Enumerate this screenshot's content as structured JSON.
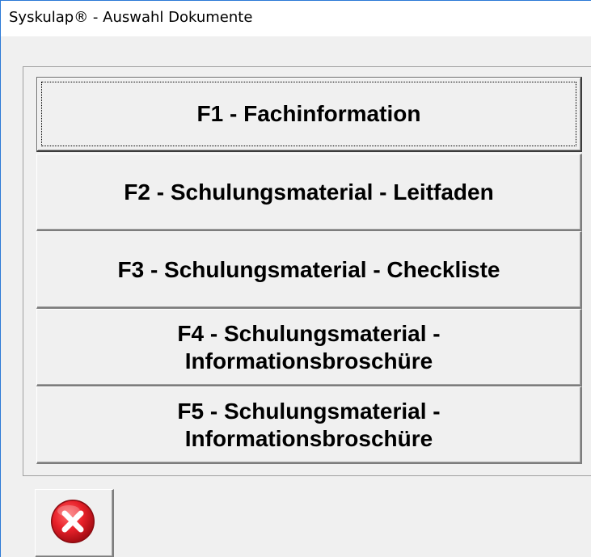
{
  "window": {
    "title": "Syskulap® - Auswahl Dokumente"
  },
  "documents": [
    {
      "label": "F1 - Fachinformation",
      "focused": true
    },
    {
      "label": "F2 - Schulungsmaterial - Leitfaden",
      "focused": false
    },
    {
      "label": "F3 - Schulungsmaterial - Checkliste",
      "focused": false
    },
    {
      "label": "F4 - Schulungsmaterial -\nInformationsbroschüre",
      "focused": false
    },
    {
      "label": "F5 - Schulungsmaterial -\nInformationsbroschüre",
      "focused": false
    }
  ],
  "footer": {
    "close_icon": "close-icon",
    "icon_color": "#e8212a"
  }
}
